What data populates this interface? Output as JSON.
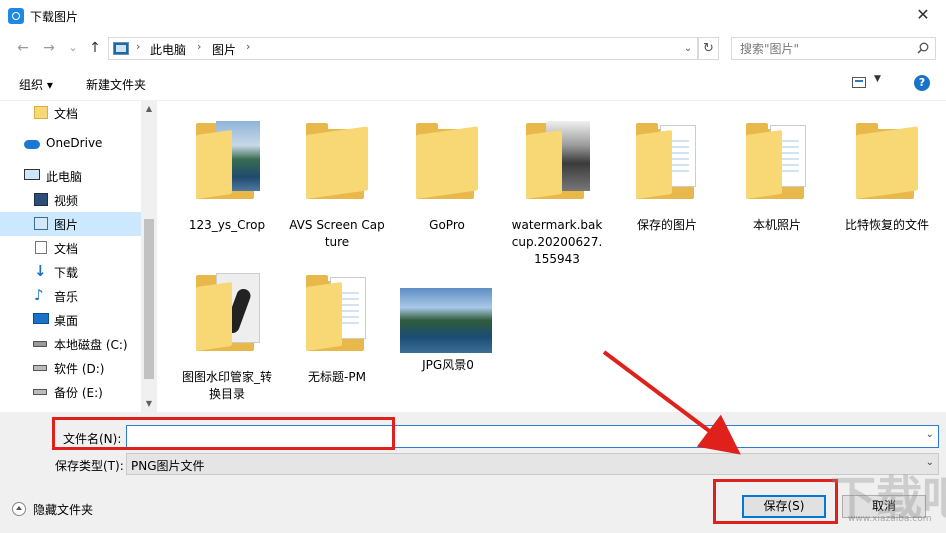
{
  "window": {
    "title": "下载图片",
    "close_glyph": "✕"
  },
  "nav": {
    "back_glyph": "←",
    "forward_glyph": "→",
    "recent_glyph": "⌄",
    "up_glyph": "↑",
    "breadcrumbs": [
      "此电脑",
      "图片"
    ],
    "breadcrumb_sep": "›",
    "refresh_glyph": "↻",
    "search_placeholder": "搜索\"图片\""
  },
  "toolbar": {
    "organize": "组织 ▾",
    "new_folder": "新建文件夹",
    "help": "?"
  },
  "sidebar": {
    "items": [
      {
        "label": "文档",
        "icon": "document-folder-icon"
      },
      {
        "label": "OneDrive",
        "icon": "onedrive-cloud-icon"
      },
      {
        "label": "此电脑",
        "icon": "computer-icon"
      },
      {
        "label": "视频",
        "icon": "video-icon"
      },
      {
        "label": "图片",
        "icon": "pictures-icon",
        "selected": true
      },
      {
        "label": "文档",
        "icon": "documents-icon"
      },
      {
        "label": "下载",
        "icon": "download-icon"
      },
      {
        "label": "音乐",
        "icon": "music-icon"
      },
      {
        "label": "桌面",
        "icon": "desktop-icon"
      },
      {
        "label": "本地磁盘 (C:)",
        "icon": "drive-c-icon"
      },
      {
        "label": "软件 (D:)",
        "icon": "drive-icon"
      },
      {
        "label": "备份 (E:)",
        "icon": "drive-icon"
      }
    ]
  },
  "files": [
    {
      "name": "123_ys_Crop",
      "kind": "folder-photo"
    },
    {
      "name": "AVS Screen Capture",
      "kind": "folder"
    },
    {
      "name": "GoPro",
      "kind": "folder"
    },
    {
      "name": "watermark.bakcup.20200627.155943",
      "kind": "folder-bw"
    },
    {
      "name": "保存的图片",
      "kind": "folder-paper"
    },
    {
      "name": "本机照片",
      "kind": "folder-paper"
    },
    {
      "name": "比特恢复的文件",
      "kind": "folder"
    },
    {
      "name": "图图水印管家_转换目录",
      "kind": "folder-headset"
    },
    {
      "name": "无标题-PM",
      "kind": "folder-paper"
    },
    {
      "name": "JPG风景0",
      "kind": "image"
    }
  ],
  "bottom": {
    "filename_label": "文件名(N):",
    "filename_value": "",
    "filetype_label": "保存类型(T):",
    "filetype_value": "PNG图片文件",
    "hide_folders": "隐藏文件夹",
    "save_button": "保存(S)",
    "cancel_button": "取消",
    "dropdown_glyph": "⌄"
  },
  "annotation_color": "#e0201a",
  "watermark": {
    "main": "下载吧",
    "sub": "www.xiazaiba.com"
  }
}
